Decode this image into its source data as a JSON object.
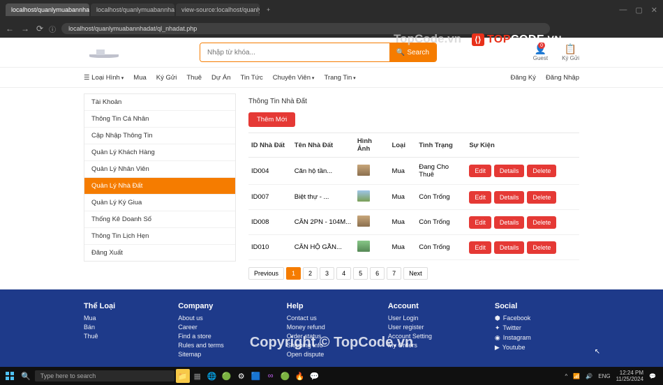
{
  "browser": {
    "tabs": [
      {
        "label": "localhost/quanlymuabannhadat..."
      },
      {
        "label": "localhost/quanlymuabannhadat..."
      },
      {
        "label": "view-source:localhost/quanlym..."
      }
    ],
    "url": "localhost/quanlymuabannhadat/ql_nhadat.php"
  },
  "watermarks": {
    "top_brand_1": "TOP",
    "top_brand_2": "CODE",
    "top_brand_3": ".VN",
    "center": "TopCode.vn",
    "copyright": "Copyright © TopCode.vn"
  },
  "search": {
    "placeholder": "Nhập từ khóa...",
    "btn": "Search"
  },
  "header_icons": {
    "guest": "Guest",
    "kygui": "Ký Gửi",
    "badge": "0"
  },
  "nav": {
    "loaihinh": "Loại Hình",
    "mua": "Mua",
    "kygui": "Ký Gửi",
    "thue": "Thuê",
    "duan": "Dự Án",
    "tintuc": "Tin Tức",
    "chuyenvien": "Chuyên Viên",
    "trangtin": "Trang Tin",
    "dangky": "Đăng Ký",
    "dangnhap": "Đăng Nhập"
  },
  "sidebar": [
    "Tài Khoản",
    "Thông Tin Cá Nhân",
    "Cập Nhập Thông Tin",
    "Quản Lý Khách Hàng",
    "Quản Lý Nhân Viên",
    "Quản Lý Nhà Đất",
    "Quản Lý Ký Giua",
    "Thống Kê Doanh Số",
    "Thông Tin Lịch Hẹn",
    "Đăng Xuất"
  ],
  "content": {
    "title": "Thông Tin Nhà Đất",
    "btn_add": "Thêm Mới",
    "headers": [
      "ID Nhà Đất",
      "Tên Nhà Đất",
      "Hình Ảnh",
      "Loại",
      "Tình Trạng",
      "Sự Kiện"
    ],
    "rows": [
      {
        "id": "ID004",
        "ten": "Căn hộ tần...",
        "loai": "Mua",
        "tinh": "Đang Cho Thuê"
      },
      {
        "id": "ID007",
        "ten": "Biệt thự - ...",
        "loai": "Mua",
        "tinh": "Còn Trống"
      },
      {
        "id": "ID008",
        "ten": "CĂN 2PN - 104M...",
        "loai": "Mua",
        "tinh": "Còn Trống"
      },
      {
        "id": "ID010",
        "ten": "CĂN HỘ GẦN...",
        "loai": "Mua",
        "tinh": "Còn Trống"
      }
    ],
    "actions": {
      "edit": "Edit",
      "details": "Details",
      "delete": "Delete"
    },
    "pagination": {
      "prev": "Previous",
      "next": "Next",
      "pages": [
        "1",
        "2",
        "3",
        "4",
        "5",
        "6",
        "7"
      ]
    }
  },
  "footer": {
    "c1_h": "Thể Loại",
    "c1": [
      "Mua",
      "Bán",
      "Thuê"
    ],
    "c2_h": "Company",
    "c2": [
      "About us",
      "Career",
      "Find a store",
      "Rules and terms",
      "Sitemap"
    ],
    "c3_h": "Help",
    "c3": [
      "Contact us",
      "Money refund",
      "Order status",
      "Shipping info",
      "Open dispute"
    ],
    "c4_h": "Account",
    "c4": [
      "User Login",
      "User register",
      "Account Setting",
      "My Orders"
    ],
    "c5_h": "Social",
    "c5": [
      "Facebook",
      "Twitter",
      "Instagram",
      "Youtube"
    ]
  },
  "taskbar": {
    "search": "Type here to search",
    "time": "12:24 PM",
    "date": "11/25/2024",
    "lang": "ENG"
  }
}
